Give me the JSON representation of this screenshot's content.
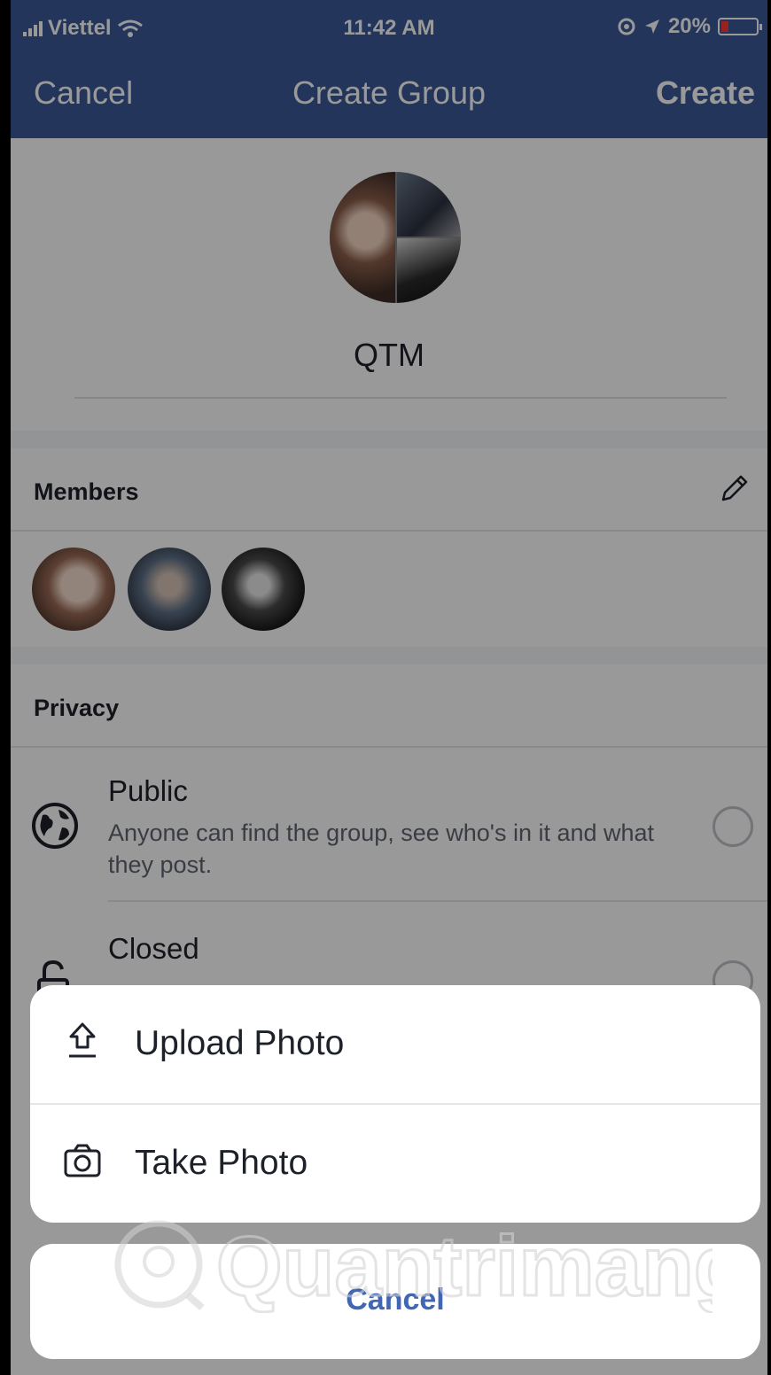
{
  "status_bar": {
    "carrier": "Viettel",
    "time": "11:42 AM",
    "battery": "20%",
    "battery_level": 0.2
  },
  "nav": {
    "cancel": "Cancel",
    "title": "Create Group",
    "create": "Create"
  },
  "group": {
    "name": "QTM"
  },
  "members": {
    "title": "Members",
    "count": 3
  },
  "privacy": {
    "title": "Privacy",
    "options": [
      {
        "title": "Public",
        "description": "Anyone can find the group, see who's in it and what they post.",
        "icon": "globe-icon"
      },
      {
        "title": "Closed",
        "description": "",
        "icon": "lock-icon"
      }
    ]
  },
  "action_sheet": {
    "items": [
      {
        "label": "Upload Photo",
        "icon": "upload-icon"
      },
      {
        "label": "Take Photo",
        "icon": "camera-icon"
      }
    ],
    "cancel": "Cancel"
  },
  "watermark": "Quantrimang",
  "colors": {
    "brand": "#3b5998",
    "link": "#4267b2",
    "battery_low": "#ff3b30"
  }
}
